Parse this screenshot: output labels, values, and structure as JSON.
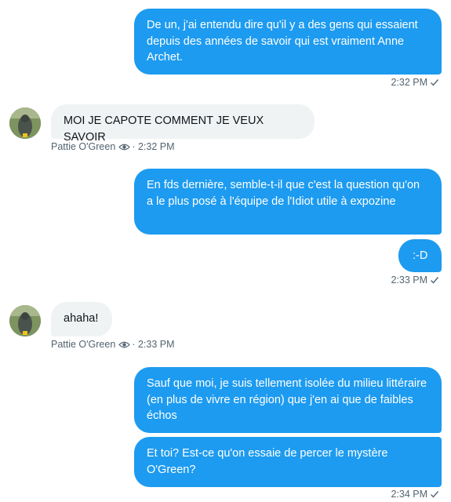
{
  "messages": {
    "m1": {
      "text": "De un, j'ai entendu dire qu'il y a des gens qui essaient depuis des années de savoir qui est vraiment Anne Archet.",
      "time": "2:32 PM"
    },
    "m2": {
      "text": "MOI JE CAPOTE COMMENT JE VEUX SAVOIR",
      "sender": "Pattie O'Green",
      "separator": "·",
      "time": "2:32 PM"
    },
    "m3": {
      "text": "En fds dernière, semble-t-il que c'est la question qu'on a le plus posé à l'équipe de l'Idiot utile à expozine"
    },
    "m4": {
      "text": ":-D",
      "time": "2:33 PM"
    },
    "m5": {
      "text": "ahaha!",
      "sender": "Pattie O'Green",
      "separator": "·",
      "time": "2:33 PM"
    },
    "m6": {
      "text": "Sauf que moi, je suis tellement isolée du milieu littéraire (en plus de vivre en région) que j'en ai que de faibles échos"
    },
    "m7": {
      "text": "Et toi? Est-ce qu'on essaie de percer le mystère O'Green?",
      "time": "2:34 PM"
    }
  },
  "colors": {
    "outgoing": "#1d9bf0",
    "incoming": "#eff3f4",
    "meta": "#536471"
  },
  "icons": {
    "read": "check-icon",
    "sender_badge": "eye-icon"
  }
}
